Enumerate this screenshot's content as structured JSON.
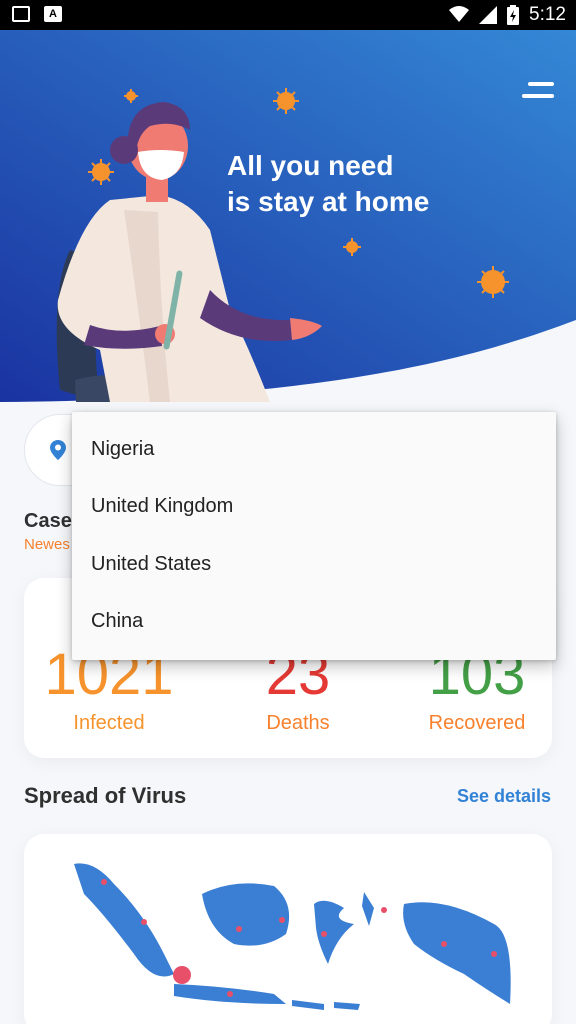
{
  "status_bar": {
    "time": "5:12"
  },
  "header": {
    "headline_line1": "All you need",
    "headline_line2": "is stay at home"
  },
  "case_update": {
    "title": "Case",
    "subtitle": "Newes"
  },
  "stats": [
    {
      "value": "1021",
      "label": "Infected"
    },
    {
      "value": "23",
      "label": "Deaths"
    },
    {
      "value": "103",
      "label": "Recovered"
    }
  ],
  "spread": {
    "title": "Spread of Virus",
    "see_details": "See details"
  },
  "dropdown": {
    "options": [
      "Nigeria",
      "United Kingdom",
      "United States",
      "China"
    ]
  },
  "colors": {
    "header_gradient_start": "#1d3aa8",
    "header_gradient_end": "#3284d4",
    "infected": "#f7932c",
    "deaths": "#e53935",
    "recovered": "#43a047",
    "accent_orange": "#f7812c",
    "link_blue": "#3282d6"
  }
}
